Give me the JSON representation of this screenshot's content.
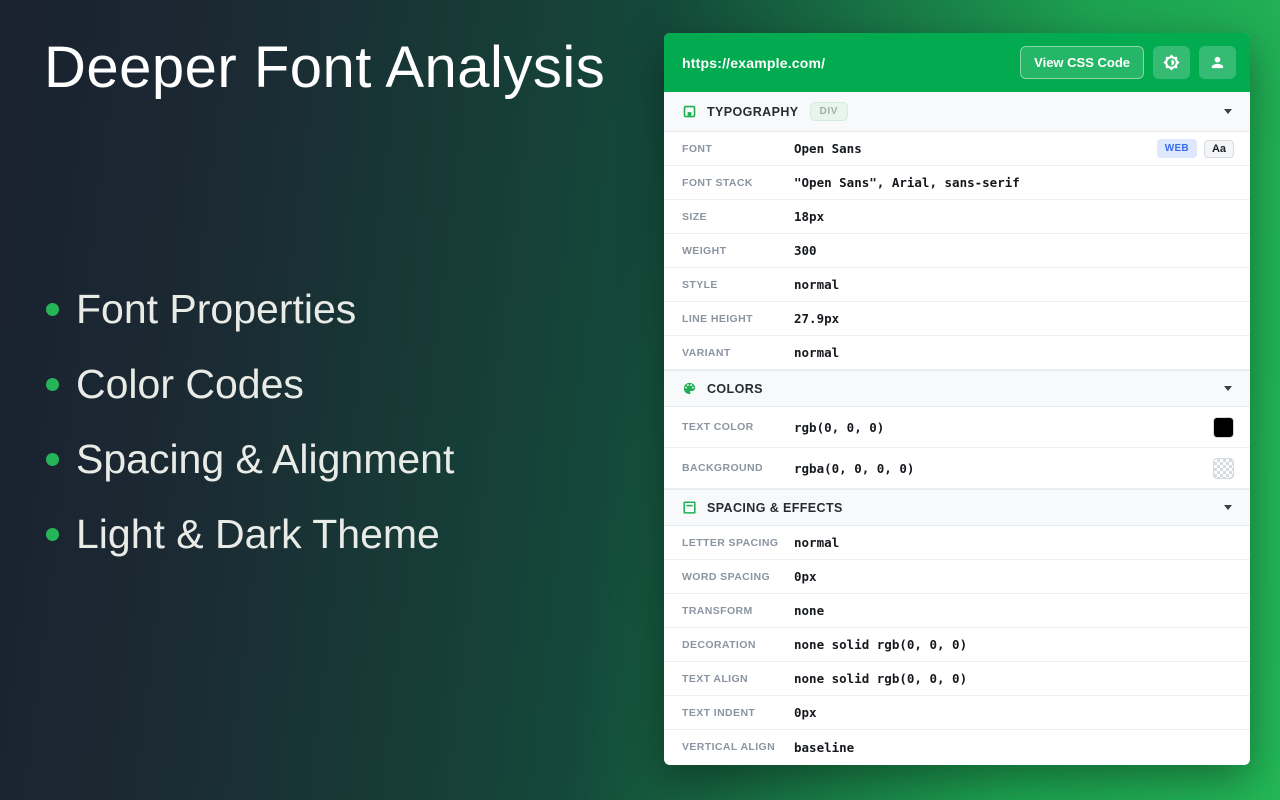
{
  "colors": {
    "accent_green": "#03ab50",
    "bullet_green": "#25b457",
    "bg_dark": "#1a212f",
    "bg_green": "#23b757",
    "text_swatch": "#000000",
    "background_swatch": "transparent"
  },
  "hero": {
    "title": "Deeper Font Analysis",
    "bullets": [
      "Font Properties",
      "Color Codes",
      "Spacing & Alignment",
      "Light & Dark Theme"
    ]
  },
  "widget": {
    "header": {
      "url": "https://example.com/",
      "view_css_button": "View CSS Code"
    },
    "sections": [
      {
        "title": "TYPOGRAPHY",
        "badge": "DIV",
        "rows": [
          {
            "label": "FONT",
            "value": "Open Sans",
            "badges": {
              "web": "WEB",
              "preview": "Aa"
            }
          },
          {
            "label": "FONT STACK",
            "value": "\"Open Sans\", Arial, sans-serif"
          },
          {
            "label": "SIZE",
            "value": "18px"
          },
          {
            "label": "WEIGHT",
            "value": "300"
          },
          {
            "label": "STYLE",
            "value": "normal"
          },
          {
            "label": "LINE HEIGHT",
            "value": "27.9px"
          },
          {
            "label": "VARIANT",
            "value": "normal"
          }
        ]
      },
      {
        "title": "COLORS",
        "rows": [
          {
            "label": "TEXT COLOR",
            "value": "rgb(0, 0, 0)",
            "swatch": "#000000"
          },
          {
            "label": "BACKGROUND",
            "value": "rgba(0, 0, 0, 0)",
            "swatch": "transparent"
          }
        ]
      },
      {
        "title": "SPACING & EFFECTS",
        "rows": [
          {
            "label": "LETTER SPACING",
            "value": "normal"
          },
          {
            "label": "WORD SPACING",
            "value": "0px"
          },
          {
            "label": "TRANSFORM",
            "value": "none"
          },
          {
            "label": "DECORATION",
            "value": "none solid rgb(0, 0, 0)"
          },
          {
            "label": "TEXT ALIGN",
            "value": "none solid rgb(0, 0, 0)"
          },
          {
            "label": "TEXT INDENT",
            "value": "0px"
          },
          {
            "label": "VERTICAL ALIGN",
            "value": "baseline"
          }
        ]
      }
    ]
  }
}
